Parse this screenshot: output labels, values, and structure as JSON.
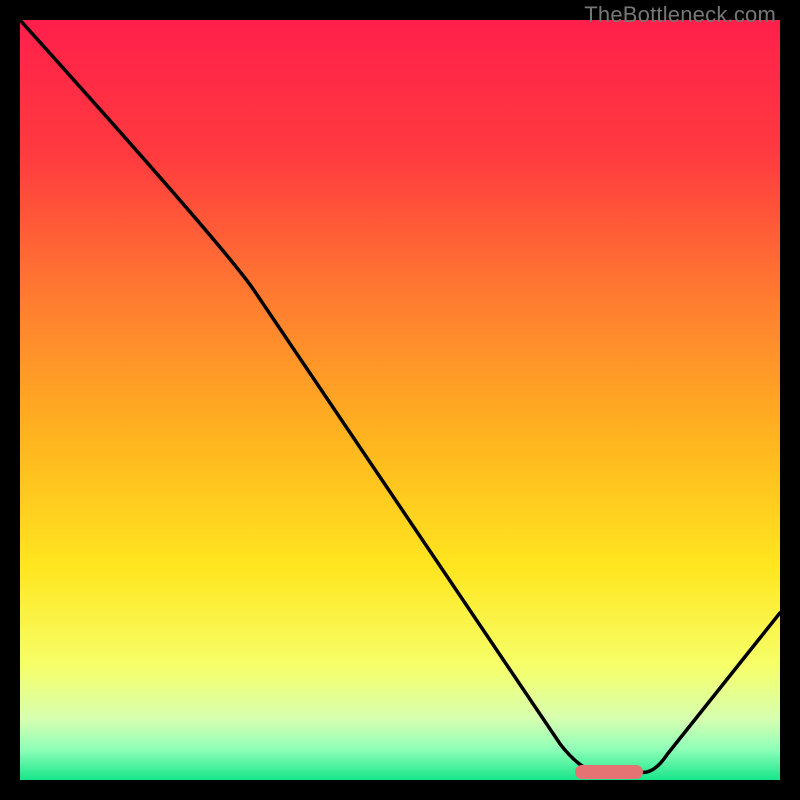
{
  "watermark": "TheBottleneck.com",
  "chart_data": {
    "type": "line",
    "title": "",
    "xlabel": "",
    "ylabel": "",
    "xlim": [
      0,
      100
    ],
    "ylim": [
      0,
      100
    ],
    "x": [
      0,
      27,
      74,
      82,
      100
    ],
    "values": [
      100,
      70,
      1,
      1,
      22
    ],
    "annotations": [
      {
        "name": "optimal-marker",
        "x_start": 73,
        "x_end": 82,
        "y": 1
      }
    ],
    "gradient_stops": [
      {
        "pct": 0,
        "color": "#ff1f4b"
      },
      {
        "pct": 18,
        "color": "#ff3b3f"
      },
      {
        "pct": 38,
        "color": "#ff802f"
      },
      {
        "pct": 55,
        "color": "#ffb41f"
      },
      {
        "pct": 72,
        "color": "#ffe61f"
      },
      {
        "pct": 85,
        "color": "#f6ff6a"
      },
      {
        "pct": 92,
        "color": "#d6ffb0"
      },
      {
        "pct": 96,
        "color": "#8effb8"
      },
      {
        "pct": 100,
        "color": "#17e58a"
      }
    ]
  }
}
